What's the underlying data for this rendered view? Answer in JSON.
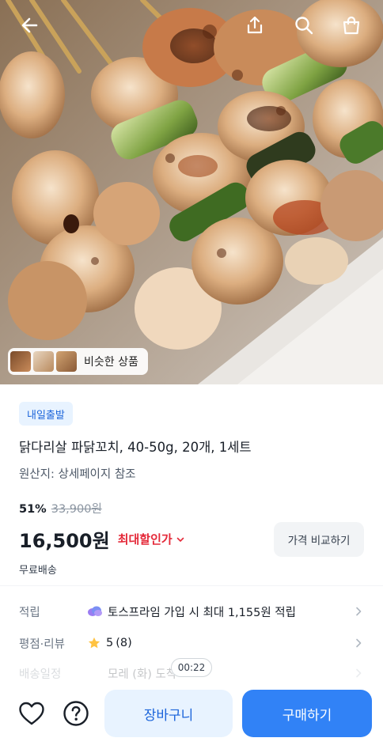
{
  "header": {
    "icons": [
      "back-arrow-icon",
      "share-icon",
      "search-icon",
      "shopping-bag-icon"
    ]
  },
  "hero": {
    "image": "grilled-chicken-green-onion-skewers-photo",
    "similar_products_label": "비슷한 상품"
  },
  "product": {
    "badge": "내일출발",
    "title": "닭다리살 파닭꼬치, 40-50g, 20개, 1세트",
    "origin": "원산지: 상세페이지 참조",
    "discount_rate": "51%",
    "original_price": "33,900원",
    "price": "16,500원",
    "max_discount_label": "최대할인가",
    "compare_button": "가격 비교하기",
    "shipping": "무료배송"
  },
  "info_rows": {
    "points": {
      "label": "적립",
      "value": "토스프라임 가입 시 최대 1,155원 적립"
    },
    "rating": {
      "label": "평점·리뷰",
      "score": "5",
      "count": "(8)"
    },
    "delivery": {
      "label": "배송일정",
      "value": "모레 (화) 도착"
    }
  },
  "video_timer": "00:22",
  "bottom_bar": {
    "cart_button": "장바구니",
    "buy_button": "구매하기"
  },
  "colors": {
    "accent": "#3182f6",
    "accent_light": "#e8f3ff",
    "discount_red": "#e42939",
    "star": "#ffc342"
  }
}
